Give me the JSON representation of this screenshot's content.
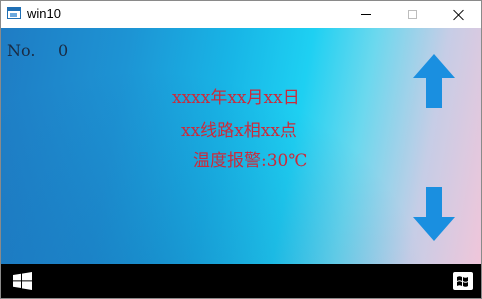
{
  "window": {
    "title": "win10",
    "icon": "application-window-icon",
    "controls": [
      "minimize-icon",
      "maximize-icon",
      "close-icon"
    ]
  },
  "panel": {
    "number_label": "No.",
    "number_value": "0",
    "alarm": {
      "date_line": "xxxx年xx月xx日",
      "location_line": "xx线路x相xx点",
      "temperature_line": "温度报警:30℃"
    },
    "scroll_up_icon": "arrow-up-icon",
    "scroll_down_icon": "arrow-down-icon",
    "colors": {
      "alarm_text": "#cc2a3a",
      "arrow": "#1a8fe0",
      "background_start": "#1f7cc4",
      "background_end": "#f0c6da"
    }
  },
  "taskbar": {
    "start_icon": "windows-logo-icon",
    "tray_icon": "windows-flag-icon",
    "background": "#000000"
  }
}
